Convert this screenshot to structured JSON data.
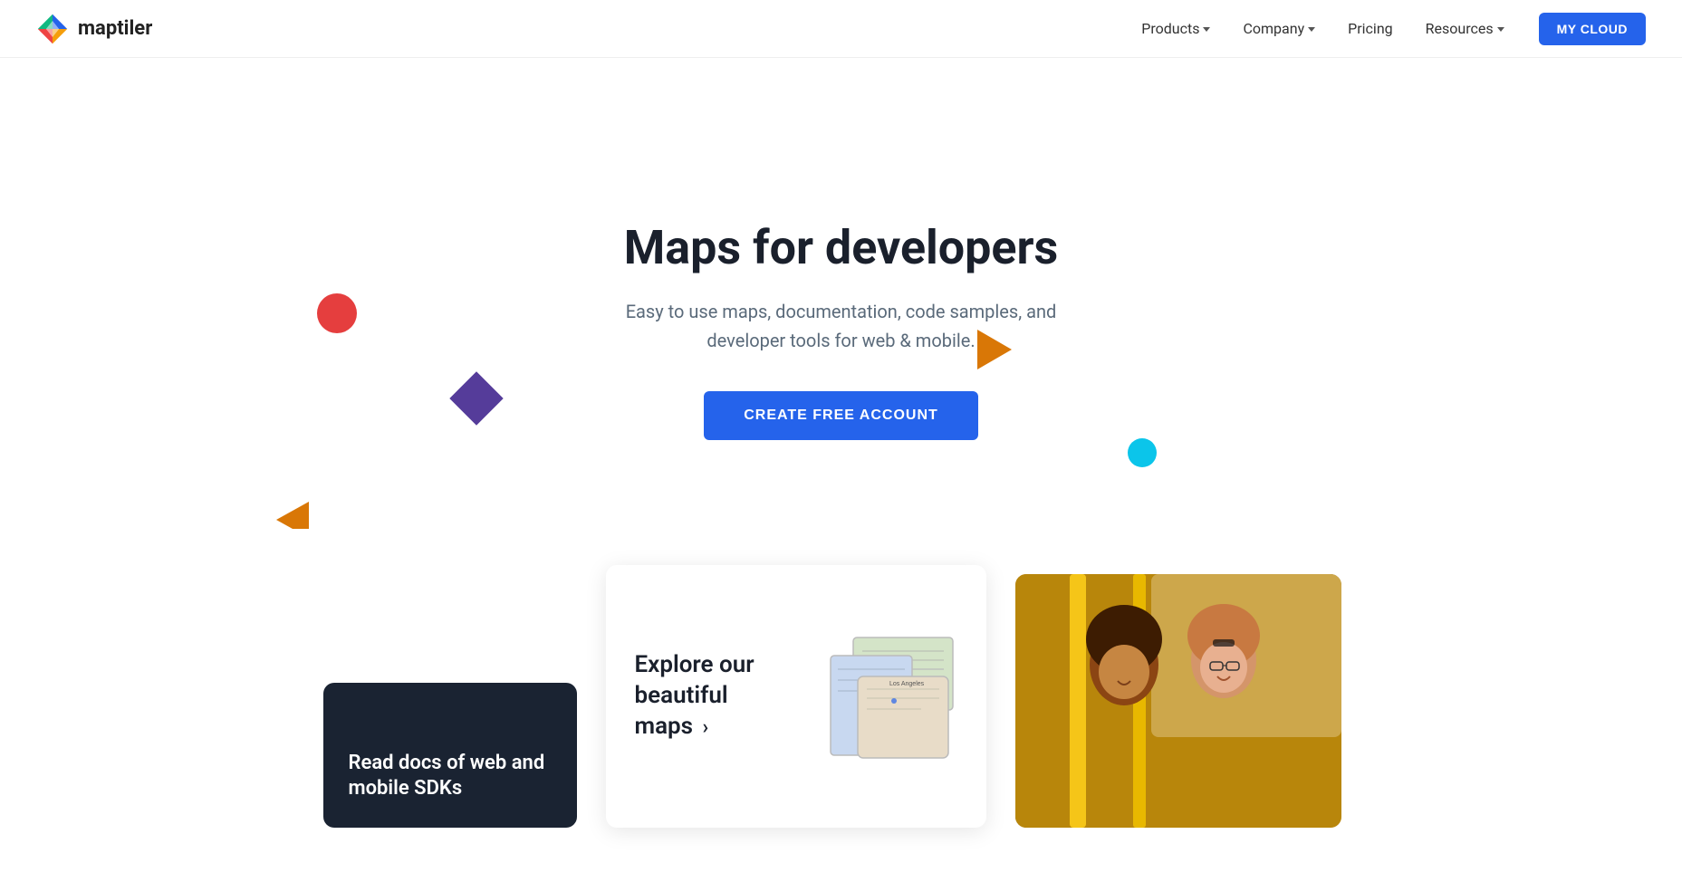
{
  "navbar": {
    "logo_text_light": "map",
    "logo_text_bold": "tiler",
    "nav_items": [
      {
        "label": "Products",
        "has_dropdown": true
      },
      {
        "label": "Company",
        "has_dropdown": true
      },
      {
        "label": "Pricing",
        "has_dropdown": false
      },
      {
        "label": "Resources",
        "has_dropdown": true
      }
    ],
    "cta_label": "MY CLOUD"
  },
  "hero": {
    "title": "Maps for developers",
    "subtitle": "Easy to use maps, documentation, code samples, and developer tools for web & mobile.",
    "cta_label": "CREATE FREE ACCOUNT"
  },
  "cards": {
    "explore_label": "Explore our beautiful maps",
    "explore_arrow": "›",
    "sdk_label": "Read docs of web and mobile SDKs"
  }
}
